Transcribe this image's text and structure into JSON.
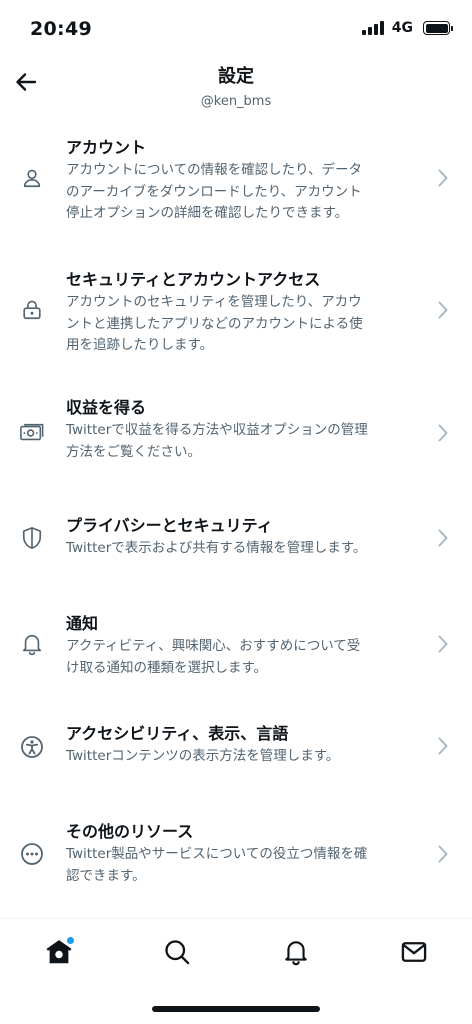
{
  "status_bar": {
    "time": "20:49",
    "network": "4G",
    "battery_level": 1.0
  },
  "header": {
    "title": "設定",
    "subtitle": "@ken_bms",
    "back_icon": "arrow-left-icon"
  },
  "settings": {
    "items": [
      {
        "label": "アカウント",
        "desc_lines": [
          "アカウントについての情報を確認したり、データ",
          "のアーカイブをダウンロードしたり、アカウント",
          "停止オプションの詳細を確認したりできます。"
        ],
        "icon": "person-icon"
      },
      {
        "label": "セキュリティとアカウントアクセス",
        "desc_lines": [
          "アカウントのセキュリティを管理したり、アカウ",
          "ントと連携したアプリなどのアカウントによる使",
          "用を追跡したりします。"
        ],
        "icon": "lock-icon"
      },
      {
        "label": "収益を得る",
        "desc_lines": [
          "Twitterで収益を得る方法や収益オプションの管理",
          "方法をご覧ください。"
        ],
        "icon": "money-icon"
      },
      {
        "label": "プライバシーとセキュリティ",
        "desc_lines": [
          "Twitterで表示および共有する情報を管理します。"
        ],
        "icon": "shield-icon"
      },
      {
        "label": "通知",
        "desc_lines": [
          "アクティビティ、興味関心、おすすめについて受",
          "け取る通知の種類を選択します。"
        ],
        "icon": "bell-icon"
      },
      {
        "label": "アクセシビリティ、表示、言語",
        "desc_lines": [
          "Twitterコンテンツの表示方法を管理します。"
        ],
        "icon": "accessibility-icon"
      },
      {
        "label": "その他のリソース",
        "desc_lines": [
          "Twitter製品やサービスについての役立つ情報を確",
          "認できます。"
        ],
        "icon": "more-circle-icon"
      }
    ]
  },
  "tab_bar": {
    "tabs": [
      "home-icon",
      "search-icon",
      "notifications-icon",
      "messages-icon"
    ],
    "home_has_dot": true,
    "accent_color": "#1d9bf0"
  },
  "colors": {
    "text_primary": "#0f1419",
    "text_secondary": "#536471",
    "chevron": "#aab8c2"
  }
}
